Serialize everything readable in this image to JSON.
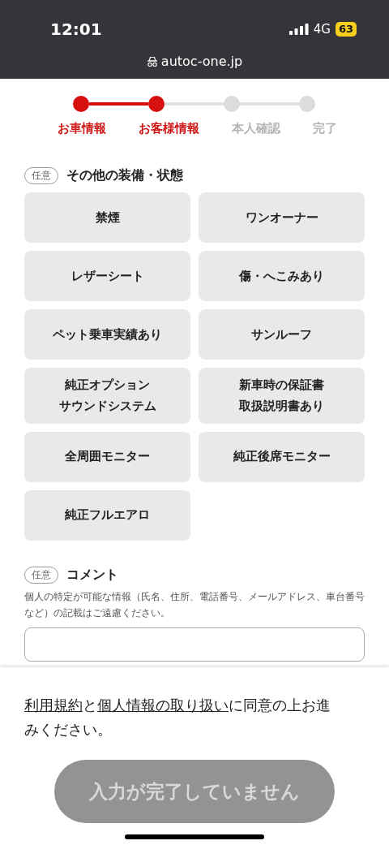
{
  "status_bar": {
    "time": "12:01",
    "network": "4G",
    "battery": "63"
  },
  "url_bar": {
    "address": "autoc-one.jp"
  },
  "steps": [
    {
      "label": "お車情報",
      "done": true
    },
    {
      "label": "お客様情報",
      "done": true
    },
    {
      "label": "本人確認",
      "done": false
    },
    {
      "label": "完了",
      "done": false
    }
  ],
  "equipment": {
    "badge": "任意",
    "title": "その他の装備・状態",
    "options": [
      {
        "label": "禁煙",
        "selected": false
      },
      {
        "label": "ワンオーナー",
        "selected": false
      },
      {
        "label": "レザーシート",
        "selected": false
      },
      {
        "label": "傷・へこみあり",
        "selected": false
      },
      {
        "label": "ペット乗車実績あり",
        "selected": false
      },
      {
        "label": "サンルーフ",
        "selected": false
      },
      {
        "label": "純正オプション",
        "label_line_2": "サウンドシステム",
        "selected": false
      },
      {
        "label": "新車時の保証書",
        "label_line_2": "取扱説明書あり",
        "selected": false
      },
      {
        "label": "全周囲モニター",
        "selected": false
      },
      {
        "label": "純正後席モニター",
        "selected": false
      },
      {
        "label": "純正フルエアロ",
        "selected": false
      }
    ]
  },
  "comment": {
    "badge": "任意",
    "title": "コメント",
    "note": "個人の特定が可能な情報（氏名、住所、電話番号、メールアドレス、車台番号など）の記載はご遠慮ください。"
  },
  "footer": {
    "consent": [
      {
        "kind": "link",
        "text": "利用規約"
      },
      {
        "kind": "text",
        "text": "と"
      },
      {
        "kind": "link",
        "text": "個人情報の取り扱い"
      },
      {
        "kind": "text",
        "text": "に同意の上お進みください。"
      }
    ],
    "submit": {
      "label": "入力が完了していません",
      "disabled": true
    }
  }
}
